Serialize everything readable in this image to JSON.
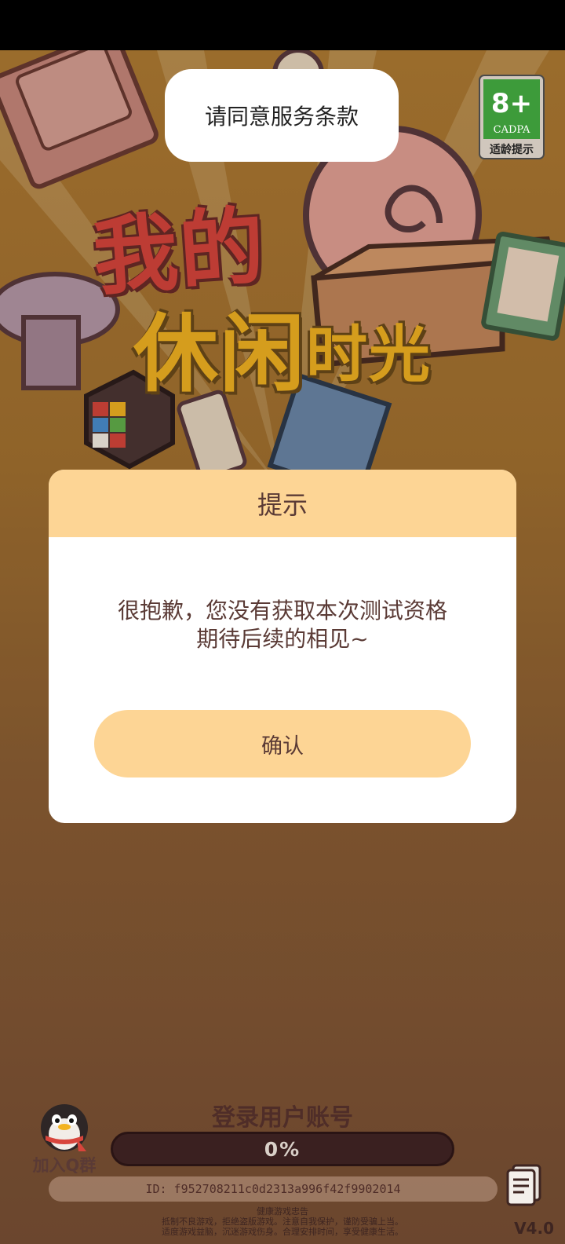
{
  "toast": {
    "message": "请同意服务条款"
  },
  "age_badge": {
    "rating": "8+",
    "org": "CADPA",
    "label": "适龄提示"
  },
  "logo": {
    "line1": "我的",
    "line2_big": "休闲",
    "line2_small": "时光"
  },
  "dialog": {
    "title": "提示",
    "message_line1": "很抱歉，您没有获取本次测试资格",
    "message_line2": "期待后续的相见~",
    "confirm_label": "确认"
  },
  "join_group": {
    "label": "加入Q群"
  },
  "login": {
    "title": "登录用户账号",
    "progress_text": "0%",
    "progress_value": 0
  },
  "user": {
    "id_text": "ID: f952708211c0d2313a996f42f9902014"
  },
  "health_notice": {
    "title": "健康游戏忠告",
    "line1": "抵制不良游戏，拒绝盗版游戏。注意自我保护，谨防受骗上当。",
    "line2": "适度游戏益脑，沉迷游戏伤身。合理安排时间，享受健康生活。"
  },
  "version": "V4.0",
  "colors": {
    "dialog_accent": "#fdd595",
    "text_brown": "#5a3a35",
    "logo_red": "#d8453c",
    "logo_yellow": "#f3b321",
    "badge_green": "#3d9b3a"
  }
}
